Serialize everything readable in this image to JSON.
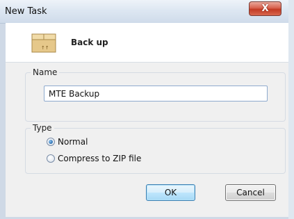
{
  "window": {
    "title": "New Task",
    "close_glyph": "X"
  },
  "header": {
    "title": "Back up",
    "icon": "box-icon"
  },
  "name_group": {
    "legend": "Name",
    "value": "MTE Backup"
  },
  "type_group": {
    "legend": "Type",
    "options": [
      {
        "label": "Normal",
        "selected": true
      },
      {
        "label": "Compress to ZIP file",
        "selected": false
      }
    ]
  },
  "buttons": {
    "ok": "OK",
    "cancel": "Cancel"
  },
  "colors": {
    "titlebar": "#dde7f2",
    "close": "#c23a23",
    "ok_border": "#3c7fb1",
    "dialog_bg": "#f0f0f0"
  }
}
